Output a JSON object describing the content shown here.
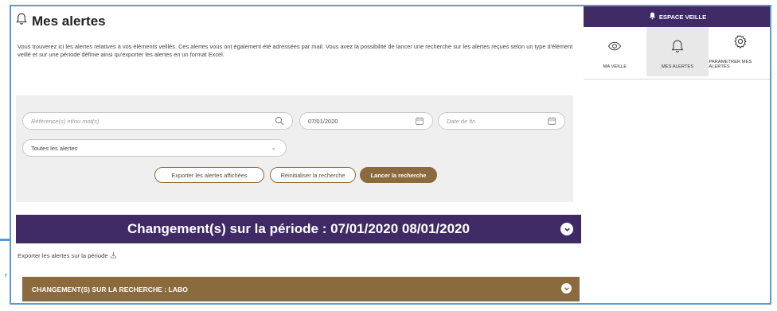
{
  "colors": {
    "purple": "#3f2a66",
    "brown": "#8b6a3e",
    "panel_grey": "#efefef",
    "frame_blue": "#5b9bd5"
  },
  "page": {
    "title": "Mes alertes",
    "title_icon": "bell-outline-icon",
    "intro": "Vous trouverez ici les alertes relatives à vos éléments veillés. Ces alertes vous ont également été adressées par mail. Vous avez la possibilité de lancer une recherche sur les alertes reçues selon un type d'élément veillé et sur une période définie ainsi qu'exporter les alertes en un format Excel."
  },
  "search": {
    "reference_placeholder": "Référence(s) et/ou mot(s)",
    "reference_icon": "search-icon",
    "start_date": "07/01/2020",
    "end_date_placeholder": "Date de fin",
    "calendar_icon": "calendar-icon",
    "alerts_filter": "Toutes les alertes",
    "alerts_filter_icon": "chevron-down-icon",
    "export_label": "Exporter les alertes affichées",
    "reset_label": "Réinitialiser la recherche",
    "run_label": "Lancer la recherche"
  },
  "results": {
    "period_heading": "Changement(s) sur la période : 07/01/2020 08/01/2020",
    "period_toggle_icon": "chevron-down-circle-icon",
    "export_period_label": "Exporter les alertes sur la période",
    "export_period_icon": "download-icon",
    "search_section_label": "CHANGEMENT(S) SUR LA RECHERCHE : LABO",
    "search_section_toggle_icon": "chevron-down-circle-icon"
  },
  "sidebar": {
    "header": "ESPACE VEILLE",
    "header_icon": "bell-filled-icon",
    "items": [
      {
        "label": "MA VEILLE",
        "icon": "eye-icon",
        "active": false
      },
      {
        "label": "MES ALERTES",
        "icon": "bell-outline-icon",
        "active": true
      },
      {
        "label": "PARAMETRER MES ALERTES",
        "icon": "gear-icon",
        "active": false
      }
    ]
  },
  "outside": {
    "stray_mark": ","
  }
}
